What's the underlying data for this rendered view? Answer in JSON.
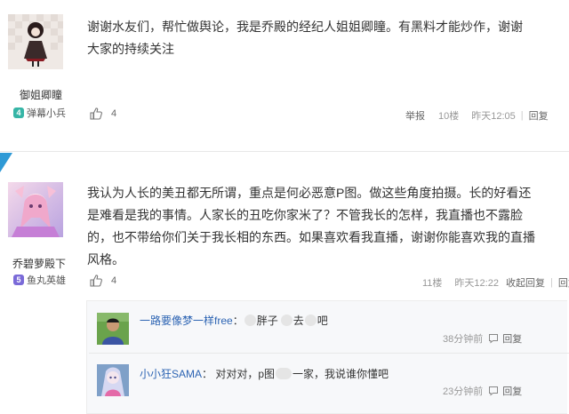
{
  "post1": {
    "username": "御姐卿瞳",
    "level": "4",
    "rank": "弹幕小兵",
    "content": "谢谢水友们，帮忙做舆论，我是乔殿的经纪人姐姐卿瞳。有黑料才能炒作，谢谢大家的持续关注",
    "likes": "4",
    "report": "举报",
    "floor": "10楼",
    "time": "昨天12:05",
    "reply": "回复"
  },
  "post2": {
    "username": "乔碧萝殿下",
    "level": "5",
    "rank": "鱼丸英雄",
    "content": "我认为人长的美丑都无所谓，重点是何必恶意P图。做这些角度拍摄。长的好看还是难看是我的事情。人家长的丑吃你家米了？不管我长的怎样，我直播也不露脸的，也不带给你们关于我长相的东西。如果喜欢看我直播，谢谢你能喜欢我的直播风格。",
    "likes": "4",
    "floor": "11楼",
    "time": "昨天12:22",
    "collapse": "收起回复",
    "reply": "回复"
  },
  "replies": [
    {
      "username": "一路要像梦一样free",
      "text_a": "：",
      "text_b": "胖子",
      "text_c": "去",
      "text_d": "吧",
      "time": "38分钟前",
      "reply": "回复"
    },
    {
      "username": "小小狂SAMA",
      "text_a": "：  对对对，p图",
      "text_b": "一家，我说谁你懂吧",
      "time": "23分钟前",
      "reply": "回复"
    }
  ],
  "colors": {
    "link": "#2d64b3",
    "corner": "#2f9ad6",
    "level4": "#36b5a6",
    "level5": "#7a6ad8"
  }
}
